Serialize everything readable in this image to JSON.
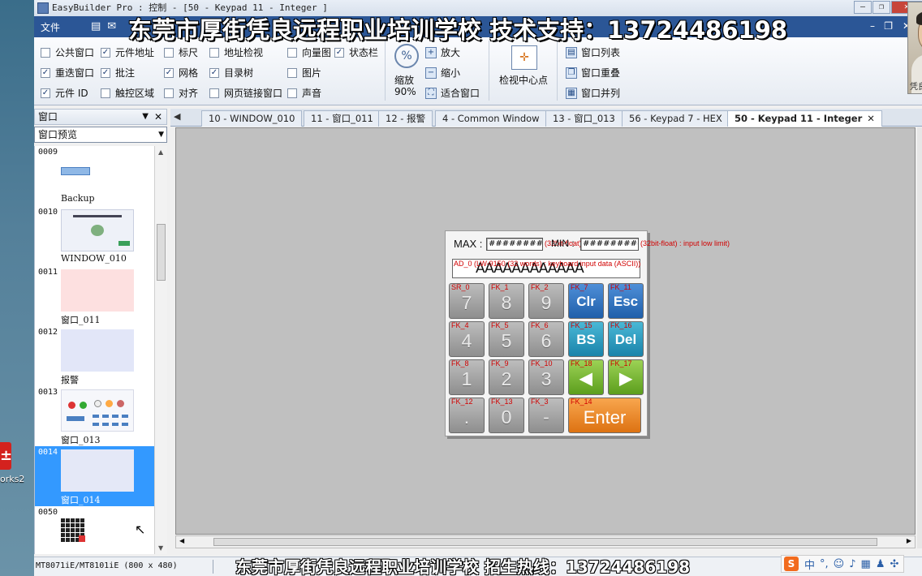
{
  "window": {
    "title": "EasyBuilder Pro : 控制 - [50 - Keypad 11 - Integer ]"
  },
  "desktop": {
    "icon_label": "orks2"
  },
  "banner": {
    "top": "东莞市厚街凭良远程职业培训学校  技术支持：13724486198",
    "bottom": "东莞市厚街凭良远程职业培训学校  招生热线：13724486198"
  },
  "ribbon": {
    "file_tab": "文件",
    "checkboxes": [
      {
        "label": "公共窗口",
        "checked": false
      },
      {
        "label": "元件地址",
        "checked": true
      },
      {
        "label": "标尺",
        "checked": false
      },
      {
        "label": "地址检视",
        "checked": false
      },
      {
        "label": "向量图",
        "checked": false
      },
      {
        "label": "状态栏",
        "checked": true
      },
      {
        "label": "重迭窗口",
        "checked": true
      },
      {
        "label": "批注",
        "checked": true
      },
      {
        "label": "网格",
        "checked": true
      },
      {
        "label": "目录树",
        "checked": true
      },
      {
        "label": "图片",
        "checked": false
      },
      {
        "label": "元件 ID",
        "checked": true
      },
      {
        "label": "触控区域",
        "checked": false
      },
      {
        "label": "对齐",
        "checked": false
      },
      {
        "label": "网页链接窗口",
        "checked": false
      },
      {
        "label": "声音",
        "checked": false
      }
    ],
    "zoom_label": "缩放",
    "zoom_value": "90%",
    "zoom_in": "放大",
    "zoom_out": "缩小",
    "fit_window": "适合窗口",
    "view_center": "检视中心点",
    "window_list": "窗口列表",
    "window_cascade": "窗口重叠",
    "window_tile": "窗口并列"
  },
  "webcam": {
    "caption": "凭良:1..."
  },
  "left_pane": {
    "title": "窗口",
    "dropdown": "窗口预览",
    "items": [
      {
        "num": "0009",
        "label": "Backup"
      },
      {
        "num": "0010",
        "label": "WINDOW_010"
      },
      {
        "num": "0011",
        "label": "窗口_011"
      },
      {
        "num": "0012",
        "label": "报警"
      },
      {
        "num": "0013",
        "label": "窗口_013"
      },
      {
        "num": "0014",
        "label": "窗口_014"
      },
      {
        "num": "0050",
        "label": ""
      }
    ]
  },
  "doc_tabs": [
    {
      "label": "10 - WINDOW_010"
    },
    {
      "label": "11 - 窗口_011"
    },
    {
      "label": "12 - 报警"
    },
    {
      "label": "4 - Common Window"
    },
    {
      "label": "13 - 窗口_013"
    },
    {
      "label": "56 - Keypad 7 - HEX"
    },
    {
      "label": "50 - Keypad 11 - Integer"
    }
  ],
  "keypad": {
    "max_label": "MAX :",
    "min_label": "MIN :",
    "max_field": "###########",
    "min_field": "###########",
    "max_note": "(32bit-float) : input high",
    "min_note": "(32bit-float) : input low  limit)",
    "input_note": "AD_0 (LW-9150 (32 words) : keyboard input data (ASCII))",
    "input_value": "AAAAAAAAAAAA",
    "keys": [
      {
        "tag": "SR_0",
        "cap": "7",
        "style": "grey"
      },
      {
        "tag": "FK_1",
        "cap": "8",
        "style": "grey"
      },
      {
        "tag": "FK_2",
        "cap": "9",
        "style": "grey"
      },
      {
        "tag": "FK_7",
        "cap": "Clr",
        "style": "blue"
      },
      {
        "tag": "FK_11",
        "cap": "Esc",
        "style": "blue"
      },
      {
        "tag": "FK_4",
        "cap": "4",
        "style": "grey"
      },
      {
        "tag": "FK_5",
        "cap": "5",
        "style": "grey"
      },
      {
        "tag": "FK_6",
        "cap": "6",
        "style": "grey"
      },
      {
        "tag": "FK_15",
        "cap": "BS",
        "style": "teal"
      },
      {
        "tag": "FK_16",
        "cap": "Del",
        "style": "teal"
      },
      {
        "tag": "FK_8",
        "cap": "1",
        "style": "grey"
      },
      {
        "tag": "FK_9",
        "cap": "2",
        "style": "grey"
      },
      {
        "tag": "FK_10",
        "cap": "3",
        "style": "grey"
      },
      {
        "tag": "FK_18",
        "cap": "◀",
        "style": "green"
      },
      {
        "tag": "FK_17",
        "cap": "▶",
        "style": "green"
      },
      {
        "tag": "FK_12",
        "cap": ".",
        "style": "grey"
      },
      {
        "tag": "FK_13",
        "cap": "0",
        "style": "grey"
      },
      {
        "tag": "FK_3",
        "cap": "-",
        "style": "grey"
      },
      {
        "tag": "FK_14",
        "cap": "Enter",
        "style": "orange"
      }
    ]
  },
  "statusbar": {
    "model": "MT8071iE/MT8101iE (800 x 480)"
  },
  "ime": {
    "logo": "S",
    "mode": "中"
  }
}
